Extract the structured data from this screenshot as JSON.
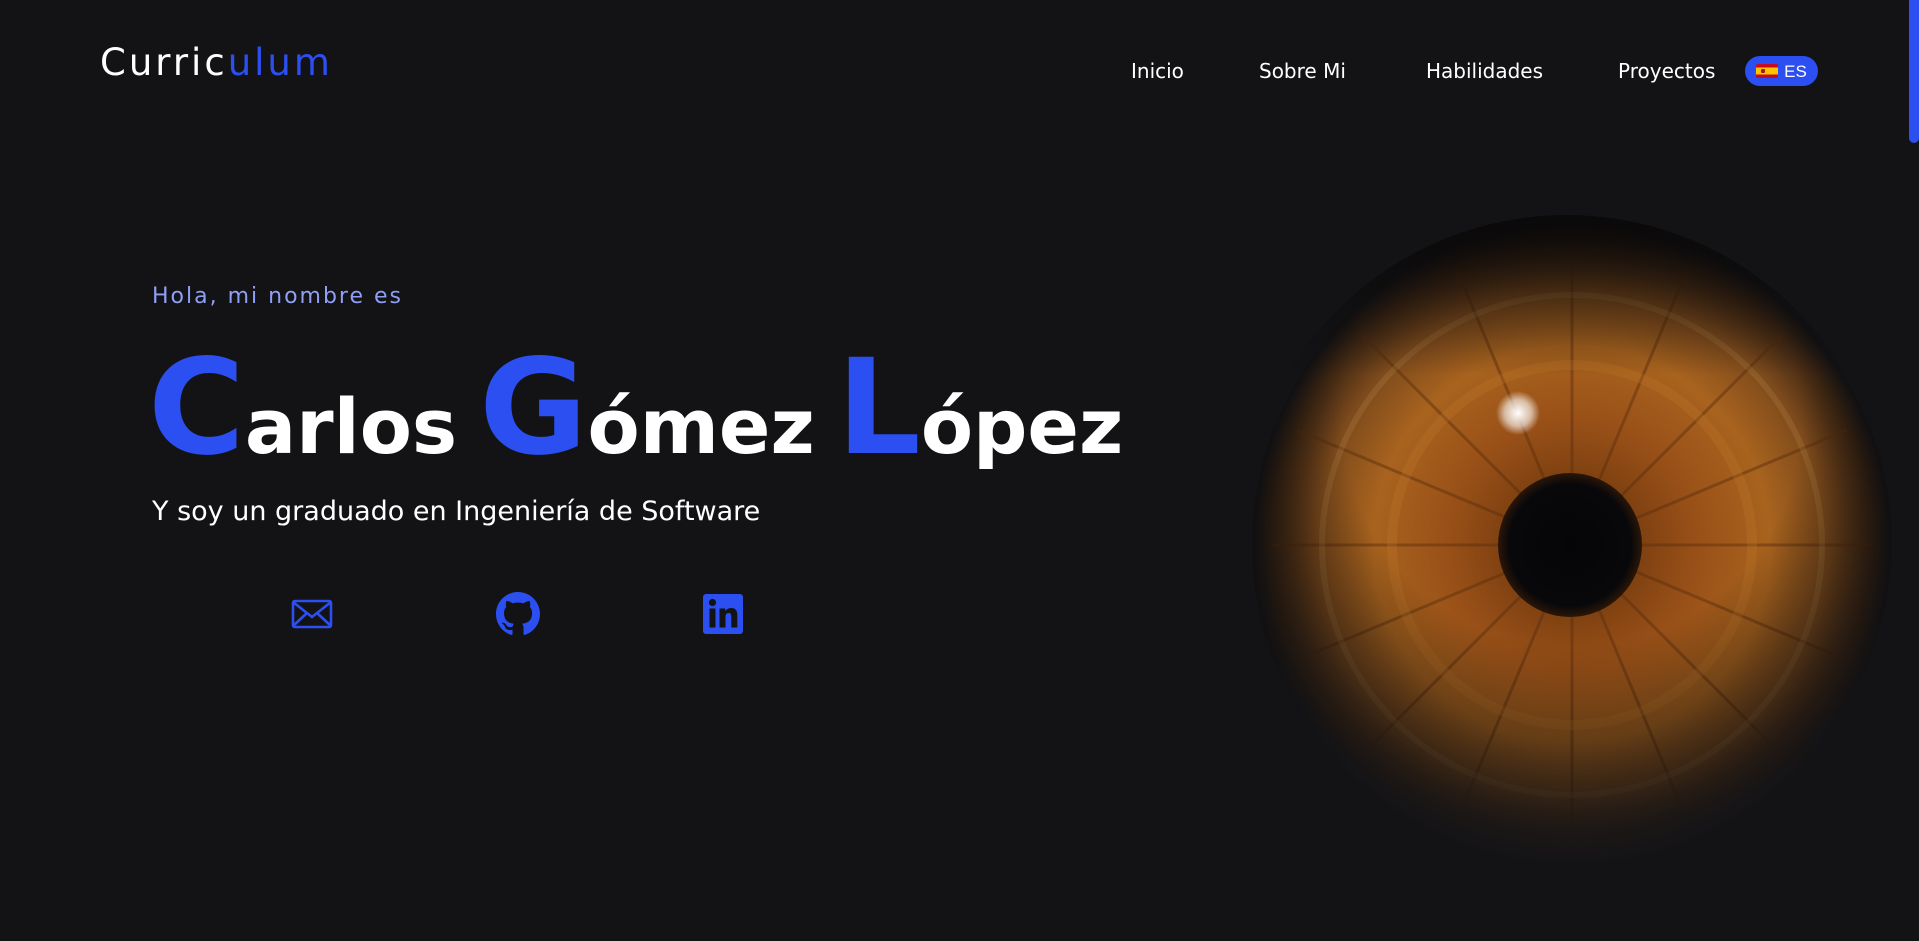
{
  "header": {
    "logo": {
      "part1": "Curric",
      "part2": "ulum"
    },
    "nav": [
      {
        "label": "Inicio"
      },
      {
        "label": "Sobre Mi"
      },
      {
        "label": "Habilidades"
      },
      {
        "label": "Proyectos"
      }
    ],
    "language": {
      "code": "ES",
      "flag_icon": "spain-flag-icon"
    }
  },
  "hero": {
    "greeting": "Hola, mi nombre es",
    "name": [
      {
        "initial": "C",
        "rest": "arlos"
      },
      {
        "initial": "G",
        "rest": "ómez"
      },
      {
        "initial": "L",
        "rest": "ópez"
      }
    ],
    "tagline": "Y soy un graduado en Ingeniería de Software",
    "social": [
      {
        "icon": "envelope-icon"
      },
      {
        "icon": "github-icon"
      },
      {
        "icon": "linkedin-icon"
      }
    ]
  },
  "colors": {
    "background": "#131316",
    "accent": "#2b4ff0",
    "greeting": "#8f9ff5",
    "text": "#ffffff"
  }
}
